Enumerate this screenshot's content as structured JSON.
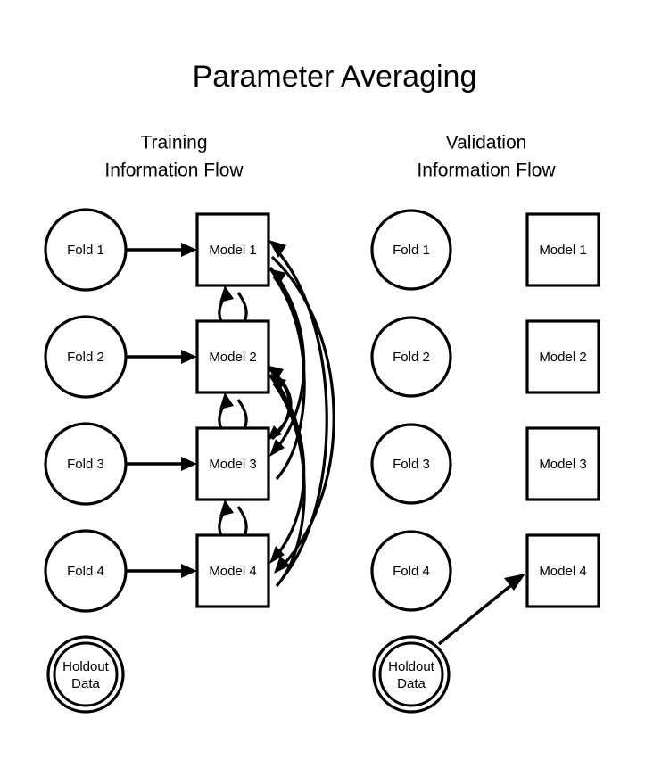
{
  "diagram": {
    "title": "Parameter Averaging",
    "background_color": "#ffffff",
    "stroke_color": "#000000",
    "columns": [
      {
        "id": "training",
        "header_line1": "Training",
        "header_line2": "Information Flow",
        "fold_labels": [
          "Fold 1",
          "Fold 2",
          "Fold 3",
          "Fold 4"
        ],
        "model_labels": [
          "Model 1",
          "Model 2",
          "Model 3",
          "Model 4"
        ],
        "holdout_line1": "Holdout",
        "holdout_line2": "Data"
      },
      {
        "id": "validation",
        "header_line1": "Validation",
        "header_line2": "Information Flow",
        "fold_labels": [
          "Fold 1",
          "Fold 2",
          "Fold 3",
          "Fold 4"
        ],
        "model_labels": [
          "Model 1",
          "Model 2",
          "Model 3",
          "Model 4"
        ],
        "holdout_line1": "Holdout",
        "holdout_line2": "Data"
      }
    ],
    "edges": {
      "training_fold_to_model": [
        "Fold 1 to Model 1",
        "Fold 2 to Model 2",
        "Fold 3 to Model 3",
        "Fold 4 to Model 4"
      ],
      "training_model_exchange": [
        "Model 1 and Model 2",
        "Model 2 and Model 3",
        "Model 3 and Model 4",
        "Model 1 and Model 3",
        "Model 2 and Model 4",
        "Model 1 and Model 4"
      ],
      "validation_holdout_to_model": [
        "Holdout Data to Model 4"
      ]
    }
  }
}
